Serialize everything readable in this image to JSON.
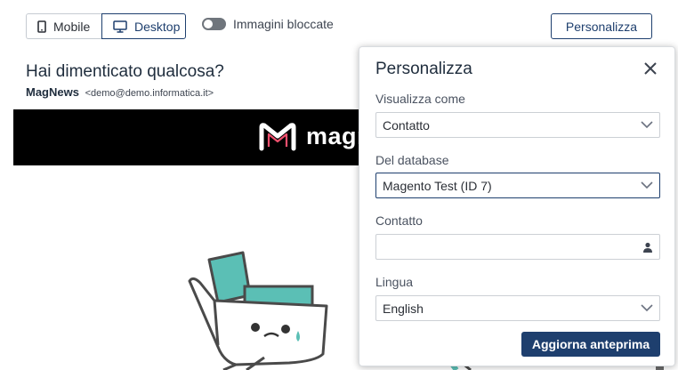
{
  "toolbar": {
    "mobile_label": "Mobile",
    "desktop_label": "Desktop",
    "images_blocked_label": "Immagini bloccate",
    "customize_label": "Personalizza"
  },
  "email": {
    "subject": "Hai dimenticato qualcosa?",
    "sender_name": "MagNews",
    "sender_address": "<demo@demo.informatica.it>",
    "banner_brand_text": "magnews"
  },
  "panel": {
    "title": "Personalizza",
    "view_as_label": "Visualizza come",
    "view_as_value": "Contatto",
    "database_label": "Del database",
    "database_value": "Magento Test (ID 7)",
    "contact_label": "Contatto",
    "contact_value": "",
    "language_label": "Lingua",
    "language_value": "English",
    "apply_label": "Aggiorna anteprima"
  },
  "colors": {
    "primary": "#1e3f6e",
    "banner_bg": "#000000",
    "cart_teal": "#5bbfb5",
    "logo_pink": "#f0506e"
  }
}
